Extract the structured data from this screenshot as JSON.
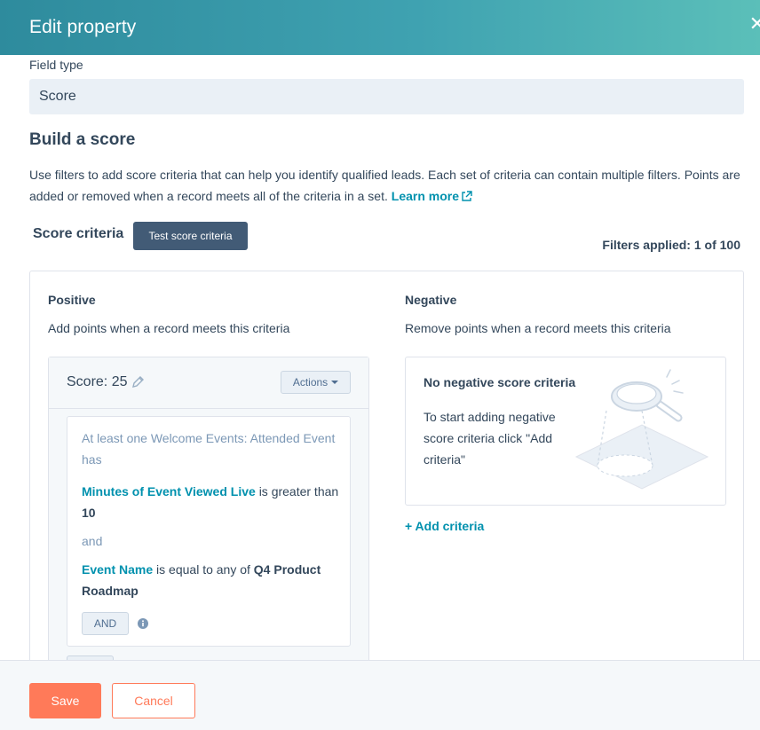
{
  "header": {
    "title": "Edit property"
  },
  "field_type": {
    "label": "Field type",
    "value": "Score"
  },
  "build": {
    "title": "Build a score",
    "description": "Use filters to add score criteria that can help you identify qualified leads. Each set of criteria can contain multiple filters. Points are added or removed when a record meets all of the criteria in a set.",
    "learn_more": "Learn more"
  },
  "criteria": {
    "label": "Score criteria",
    "test_button": "Test score criteria",
    "filters_applied": "Filters applied: 1 of 100"
  },
  "positive": {
    "title": "Positive",
    "subtitle": "Add points when a record meets this criteria",
    "score_label": "Score: 25",
    "actions_label": "Actions",
    "rule": {
      "intro": "At least one Welcome Events: Attended Event has",
      "filter1_property": "Minutes of Event Viewed Live",
      "filter1_operator": "is greater than",
      "filter1_value": "10",
      "joiner": "and",
      "filter2_property": "Event Name",
      "filter2_operator": "is equal to any of",
      "filter2_value": "Q4 Product Roadmap",
      "and_button": "AND"
    }
  },
  "negative": {
    "title": "Negative",
    "subtitle": "Remove points when a record meets this criteria",
    "empty_title": "No negative score criteria",
    "empty_text": "To start adding negative score criteria click \"Add criteria\"",
    "add_label": "+ Add criteria"
  },
  "footer": {
    "save_label": "Save",
    "cancel_label": "Cancel"
  },
  "colors": {
    "header_start": "#2e8b9d",
    "header_end": "#5bbfb9",
    "link": "#0091ae",
    "primary_button": "#ff7a59",
    "dark_button": "#425b76",
    "text": "#33475b"
  },
  "icons": [
    "close-icon",
    "external-link-icon",
    "pencil-icon",
    "caret-down-icon",
    "info-icon",
    "magnifier-illustration"
  ]
}
